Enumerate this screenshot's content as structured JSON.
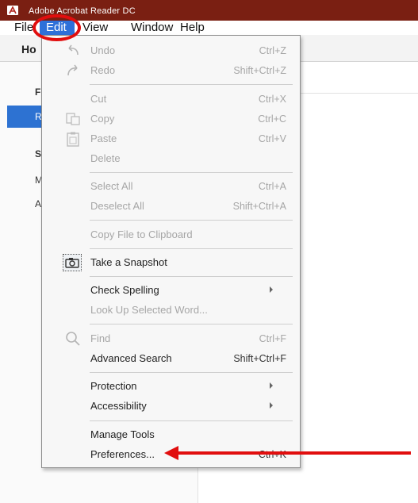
{
  "window": {
    "title": "Adobe Acrobat Reader DC"
  },
  "menubar": {
    "file": "File",
    "edit": "Edit",
    "view": "View",
    "window": "Window",
    "help": "Help"
  },
  "background": {
    "tab": "Ho",
    "panel": {
      "f": "F",
      "selected": "R",
      "s": "S",
      "m": "M",
      "a": "A"
    }
  },
  "edit_menu": {
    "undo": {
      "label": "Undo",
      "shortcut": "Ctrl+Z"
    },
    "redo": {
      "label": "Redo",
      "shortcut": "Shift+Ctrl+Z"
    },
    "cut": {
      "label": "Cut",
      "shortcut": "Ctrl+X"
    },
    "copy": {
      "label": "Copy",
      "shortcut": "Ctrl+C"
    },
    "paste": {
      "label": "Paste",
      "shortcut": "Ctrl+V"
    },
    "delete": {
      "label": "Delete"
    },
    "select_all": {
      "label": "Select All",
      "shortcut": "Ctrl+A"
    },
    "deselect_all": {
      "label": "Deselect All",
      "shortcut": "Shift+Ctrl+A"
    },
    "copy_file": {
      "label": "Copy File to Clipboard"
    },
    "snapshot": {
      "label": "Take a Snapshot"
    },
    "check_spelling": {
      "label": "Check Spelling"
    },
    "look_up": {
      "label": "Look Up Selected Word..."
    },
    "find": {
      "label": "Find",
      "shortcut": "Ctrl+F"
    },
    "advanced_search": {
      "label": "Advanced Search",
      "shortcut": "Shift+Ctrl+F"
    },
    "protection": {
      "label": "Protection"
    },
    "accessibility": {
      "label": "Accessibility"
    },
    "manage_tools": {
      "label": "Manage Tools"
    },
    "preferences": {
      "label": "Preferences...",
      "shortcut": "Ctrl+K"
    }
  },
  "icons": {
    "undo": "undo-icon",
    "redo": "redo-icon",
    "copy": "copy-icon",
    "paste": "paste-icon",
    "snapshot": "camera-icon",
    "find": "search-icon",
    "app": "acrobat-icon",
    "submenu": "chevron-right-icon"
  },
  "colors": {
    "titlebar": "#7a1f12",
    "highlight": "#2e70d9",
    "annotation": "#e10e0e",
    "disabled": "#a6a6a6"
  }
}
